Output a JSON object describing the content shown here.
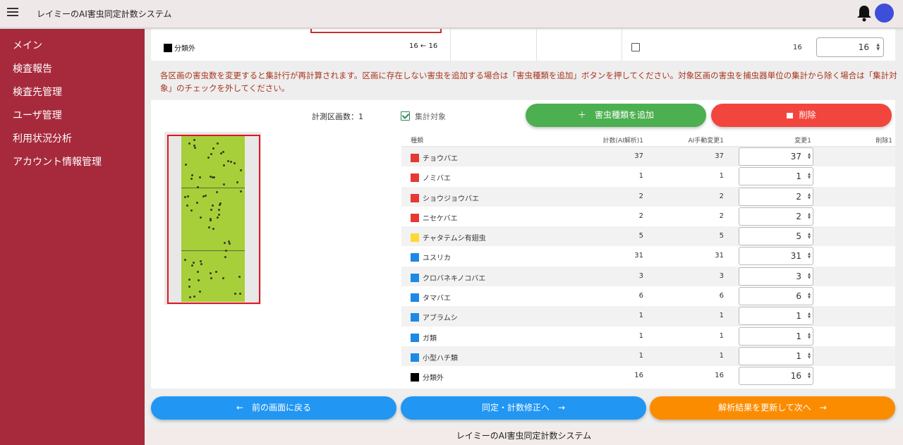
{
  "app": {
    "title": "レイミーのAI害虫同定計数システム"
  },
  "sidebar": {
    "items": [
      {
        "label": "メイン"
      },
      {
        "label": "検査報告"
      },
      {
        "label": "検査先管理"
      },
      {
        "label": "ユーザ管理"
      },
      {
        "label": "利用状況分析"
      },
      {
        "label": "アカウント情報管理"
      }
    ]
  },
  "top_card": {
    "row_label": "分類外",
    "row_count": "16 ← 16",
    "row_number": "16",
    "row_input": "16"
  },
  "notice": "各区画の害虫数を変更すると集計行が再計算されます。区画に存在しない害虫を追加する場合は「害虫種類を追加」ボタンを押してください。対象区画の害虫を捕虫器単位の集計から除く場合は「集計対象」のチェックを外してください。",
  "main": {
    "area_count": "計測区画数：1",
    "aggregate_label": "集計対象",
    "add_button": "＋　害虫種類を追加",
    "delete_button": "削除"
  },
  "table": {
    "headers": {
      "name": "種類",
      "ai": "計数(AI解析)1",
      "manual": "AI手動変更1",
      "change": "変更1",
      "delete": "削除1"
    },
    "rows": [
      {
        "name": "チョウバエ",
        "color": "#e53935",
        "ai": "37",
        "manual": "37",
        "change": "37"
      },
      {
        "name": "ノミバエ",
        "color": "#e53935",
        "ai": "1",
        "manual": "1",
        "change": "1"
      },
      {
        "name": "ショウジョウバエ",
        "color": "#e53935",
        "ai": "2",
        "manual": "2",
        "change": "2"
      },
      {
        "name": "ニセケバエ",
        "color": "#e53935",
        "ai": "2",
        "manual": "2",
        "change": "2"
      },
      {
        "name": "チャタテムシ有翅虫",
        "color": "#fdd835",
        "ai": "5",
        "manual": "5",
        "change": "5"
      },
      {
        "name": "ユスリカ",
        "color": "#1e88e5",
        "ai": "31",
        "manual": "31",
        "change": "31"
      },
      {
        "name": "クロバネキノコバエ",
        "color": "#1e88e5",
        "ai": "3",
        "manual": "3",
        "change": "3"
      },
      {
        "name": "タマバエ",
        "color": "#1e88e5",
        "ai": "6",
        "manual": "6",
        "change": "6"
      },
      {
        "name": "アブラムシ",
        "color": "#1e88e5",
        "ai": "1",
        "manual": "1",
        "change": "1"
      },
      {
        "name": "ガ類",
        "color": "#1e88e5",
        "ai": "1",
        "manual": "1",
        "change": "1"
      },
      {
        "name": "小型ハチ類",
        "color": "#1e88e5",
        "ai": "1",
        "manual": "1",
        "change": "1"
      },
      {
        "name": "分類外",
        "color": "#000000",
        "ai": "16",
        "manual": "16",
        "change": "16"
      }
    ]
  },
  "nav": {
    "back": "←　前の画面に戻る",
    "fix": "同定・計数修正へ　→",
    "next": "解析結果を更新して次へ　→"
  },
  "footer": "レイミーのAI害虫同定計数システム",
  "colors": {
    "sidebar": "#a72a3c",
    "add": "#4caf50",
    "delete": "#f2453d",
    "nav_blue": "#2196f3",
    "nav_orange": "#fb8c00"
  }
}
